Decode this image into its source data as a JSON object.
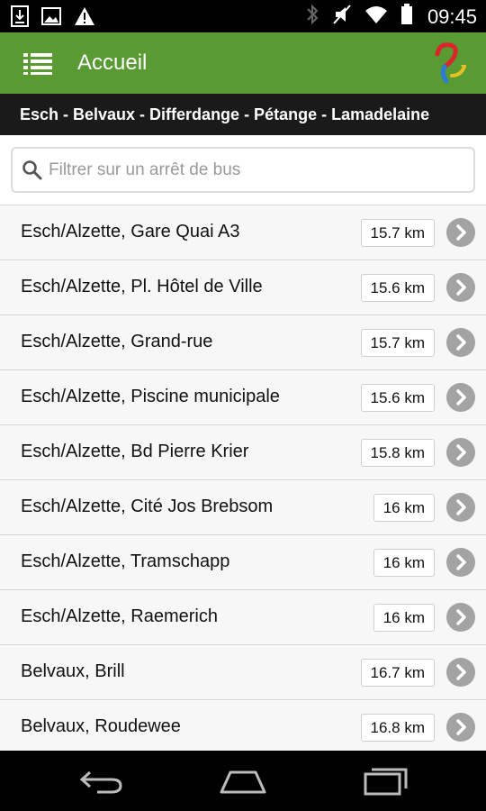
{
  "status_bar": {
    "time": "09:45",
    "left_icons": [
      "download-icon",
      "image-icon",
      "warning-icon"
    ],
    "right_icons": [
      "bluetooth-icon",
      "mute-icon",
      "wifi-icon",
      "battery-icon"
    ]
  },
  "app_bar": {
    "title": "Accueil",
    "menu_icon": "list-menu-icon",
    "logo_icon": "app-logo-icon",
    "color": "#5a9a33"
  },
  "route": {
    "label": "Esch - Belvaux - Differdange - Pétange - Lamadelaine"
  },
  "search": {
    "placeholder": "Filtrer sur un arrêt de bus",
    "value": ""
  },
  "stops": [
    {
      "name": "Esch/Alzette, Gare Quai A3",
      "distance": "15.7 km"
    },
    {
      "name": "Esch/Alzette, Pl. Hôtel de Ville",
      "distance": "15.6 km"
    },
    {
      "name": "Esch/Alzette, Grand-rue",
      "distance": "15.7 km"
    },
    {
      "name": "Esch/Alzette, Piscine municipale",
      "distance": "15.6 km"
    },
    {
      "name": "Esch/Alzette, Bd Pierre Krier",
      "distance": "15.8 km"
    },
    {
      "name": "Esch/Alzette, Cité Jos Brebsom",
      "distance": "16 km"
    },
    {
      "name": "Esch/Alzette, Tramschapp",
      "distance": "16 km"
    },
    {
      "name": "Esch/Alzette, Raemerich",
      "distance": "16 km"
    },
    {
      "name": "Belvaux, Brill",
      "distance": "16.7 km"
    },
    {
      "name": "Belvaux, Roudewee",
      "distance": "16.8 km"
    }
  ],
  "nav_bar": {
    "icons": [
      "back-icon",
      "home-icon",
      "recents-icon"
    ]
  }
}
